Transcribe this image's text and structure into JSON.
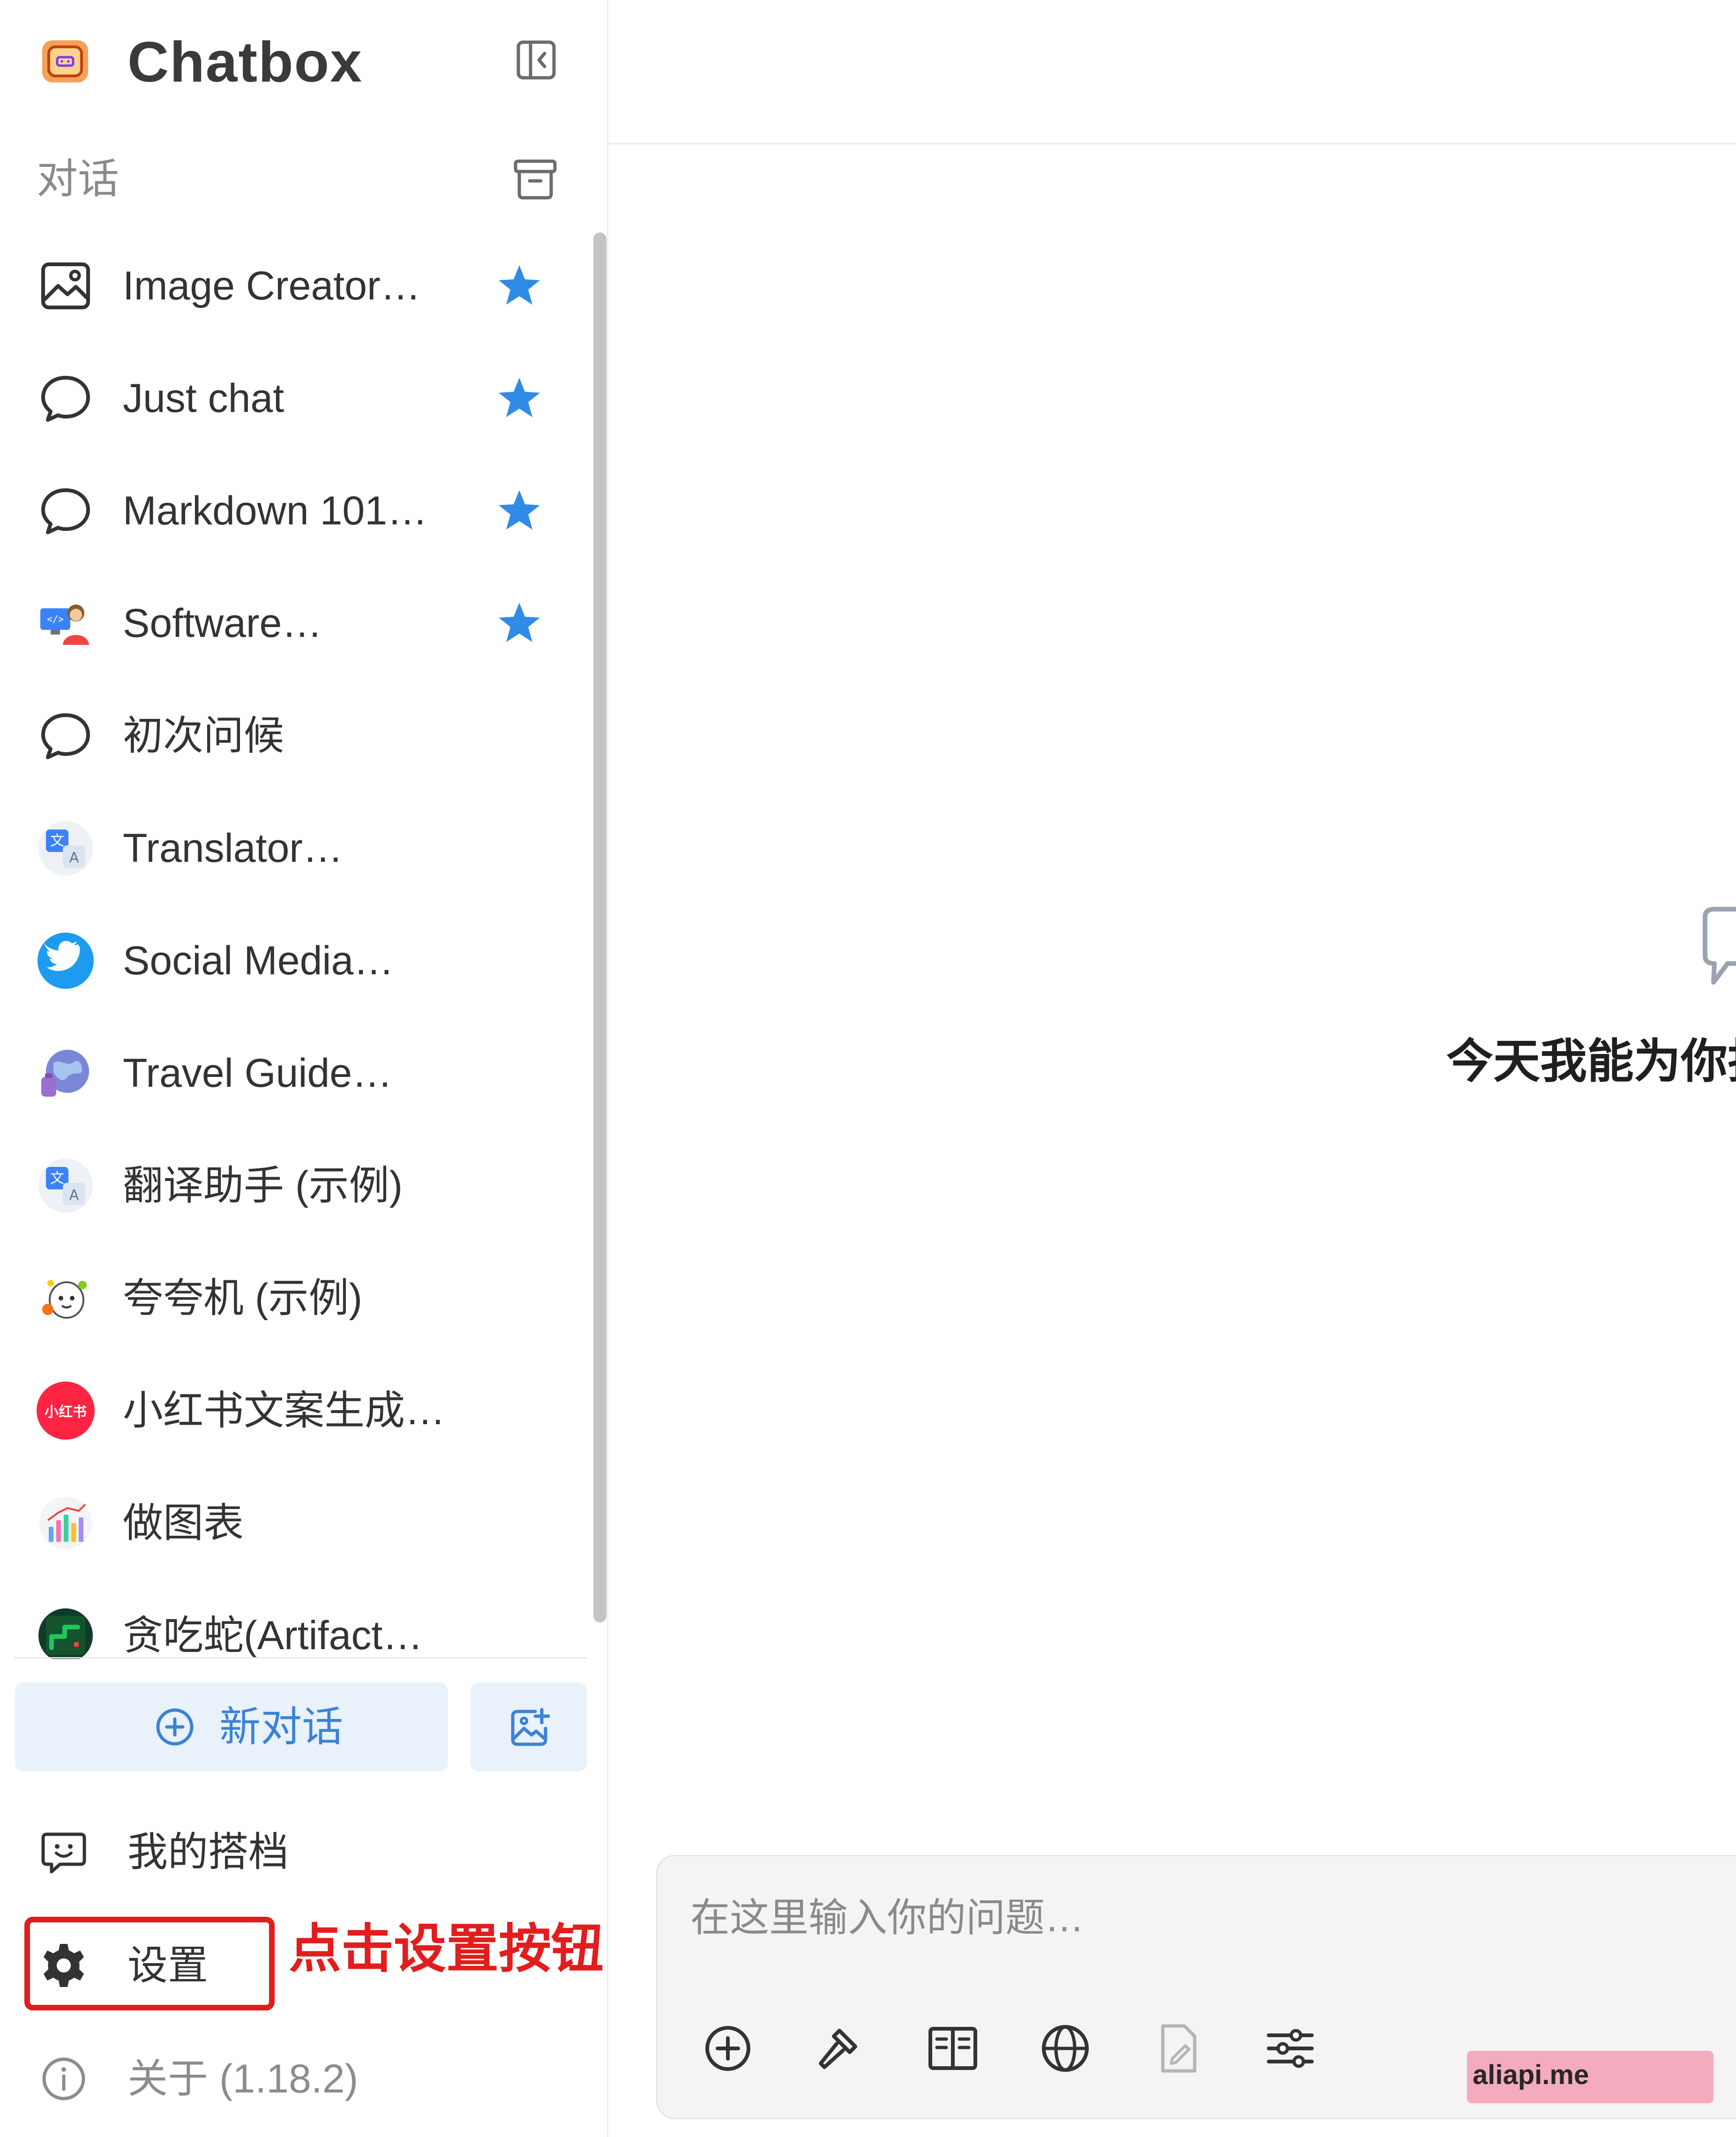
{
  "app": {
    "title": "Chatbox"
  },
  "sidebar": {
    "section_label": "对话",
    "sessions": [
      {
        "label": "Image Creator…",
        "icon": "image-icon",
        "starred": true
      },
      {
        "label": "Just chat",
        "icon": "chat-bubble-icon",
        "starred": true
      },
      {
        "label": "Markdown 101…",
        "icon": "chat-bubble-icon",
        "starred": true
      },
      {
        "label": "Software…",
        "icon": "developer-avatar-icon",
        "starred": true
      },
      {
        "label": "初次问候",
        "icon": "chat-bubble-icon",
        "starred": false
      },
      {
        "label": "Translator…",
        "icon": "translate-icon",
        "starred": false
      },
      {
        "label": "Social Media…",
        "icon": "twitter-icon",
        "starred": false
      },
      {
        "label": "Travel Guide…",
        "icon": "globe-avatar-icon",
        "starred": false
      },
      {
        "label": "翻译助手 (示例)",
        "icon": "translate-icon",
        "starred": false
      },
      {
        "label": "夸夸机 (示例)",
        "icon": "cute-avatar-icon",
        "starred": false
      },
      {
        "label": "小红书文案生成…",
        "icon": "xiaohongshu-icon",
        "badge_text": "小红书",
        "starred": false
      },
      {
        "label": "做图表",
        "icon": "chart-avatar-icon",
        "starred": false
      },
      {
        "label": "贪吃蛇(Artifact…",
        "icon": "snake-game-icon",
        "starred": false
      }
    ],
    "new_chat_label": "新对话",
    "footer": {
      "partners_label": "我的搭档",
      "settings_label": "设置",
      "about_label": "关于 (1.18.2)"
    },
    "annotation": "点击设置按钮"
  },
  "main": {
    "greeting": "今天我能为你抖",
    "composer": {
      "placeholder": "在这里输入你的问题…"
    },
    "tools": [
      "add-attachment-icon",
      "tools-hammer-icon",
      "knowledge-book-icon",
      "web-search-globe-icon",
      "file-doc-icon",
      "settings-sliders-icon"
    ]
  },
  "watermark": "aliapi.me",
  "colors": {
    "accent": "#3b82d6",
    "star": "#2f8be6",
    "annotation_red": "#e11d1d",
    "new_chat_bg": "#e9f1fb"
  }
}
